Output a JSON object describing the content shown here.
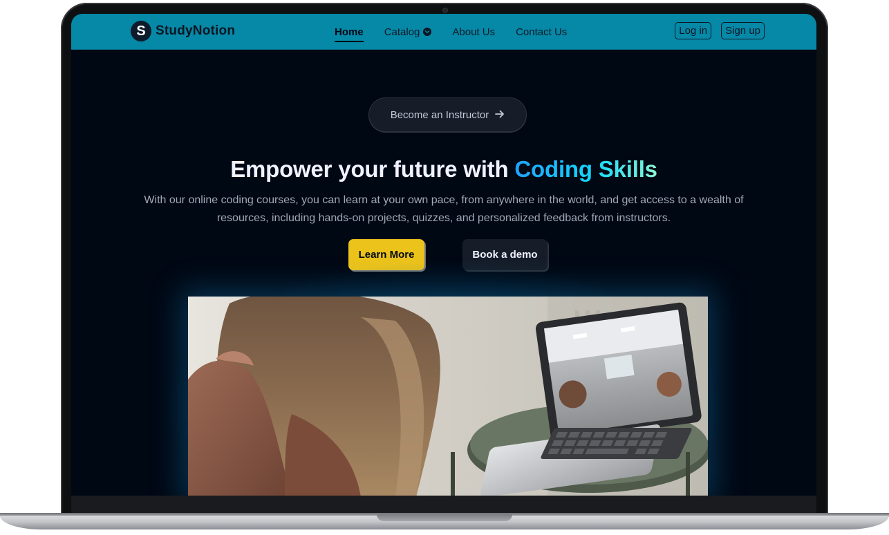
{
  "brand": {
    "logo_letter": "S",
    "name": "StudyNotion"
  },
  "nav": {
    "links": [
      {
        "label": "Home",
        "active": true
      },
      {
        "label": "Catalog",
        "has_dropdown": true
      },
      {
        "label": "About Us"
      },
      {
        "label": "Contact Us"
      }
    ],
    "login_label": "Log in",
    "signup_label": "Sign up"
  },
  "hero": {
    "instructor_label": "Become an Instructor",
    "title_prefix": "Empower your future with ",
    "title_highlight": "Coding Skills",
    "subtitle": "With our online coding courses, you can learn at your own pace, from anywhere in the world, and get access to a wealth of resources, including hands-on projects, quizzes, and personalized feedback from instructors.",
    "primary_cta": "Learn More",
    "secondary_cta": "Book a demo"
  },
  "colors": {
    "navbar": "#0688a7",
    "page_bg": "#000814",
    "accent_yellow": "#ecc31b",
    "dark_button": "#161d29",
    "highlight_gradient_start": "#1fa2ff",
    "highlight_gradient_end": "#12d8fa"
  },
  "icons": {
    "catalog_dropdown": "chevron-down-circle-icon",
    "instructor_arrow": "arrow-right-icon"
  }
}
